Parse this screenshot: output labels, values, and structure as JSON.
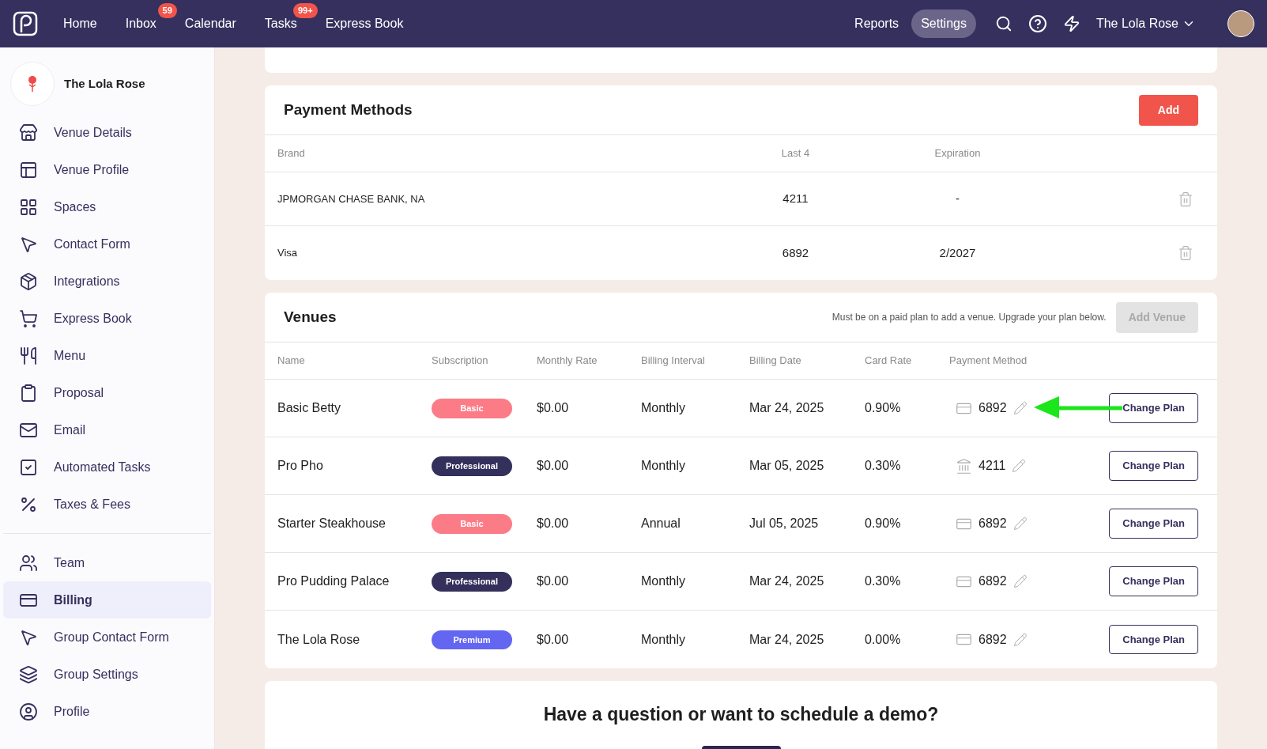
{
  "nav": {
    "items": [
      {
        "label": "Home"
      },
      {
        "label": "Inbox",
        "badge": "59"
      },
      {
        "label": "Calendar"
      },
      {
        "label": "Tasks",
        "badge": "99+"
      },
      {
        "label": "Express Book"
      }
    ],
    "right_tabs": [
      {
        "label": "Reports",
        "selected": false
      },
      {
        "label": "Settings",
        "selected": true
      }
    ],
    "account": "The Lola Rose"
  },
  "sidebar": {
    "venue_name": "The Lola Rose",
    "groups": [
      [
        {
          "label": "Venue Details",
          "selected": false
        },
        {
          "label": "Venue Profile",
          "selected": false
        },
        {
          "label": "Spaces",
          "selected": false
        },
        {
          "label": "Contact Form",
          "selected": false
        },
        {
          "label": "Integrations",
          "selected": false
        },
        {
          "label": "Express Book",
          "selected": false
        },
        {
          "label": "Menu",
          "selected": false
        },
        {
          "label": "Proposal",
          "selected": false
        },
        {
          "label": "Email",
          "selected": false
        },
        {
          "label": "Automated Tasks",
          "selected": false
        },
        {
          "label": "Taxes & Fees",
          "selected": false
        }
      ],
      [
        {
          "label": "Team",
          "selected": false
        },
        {
          "label": "Billing",
          "selected": true
        },
        {
          "label": "Group Contact Form",
          "selected": false
        },
        {
          "label": "Group Settings",
          "selected": false
        },
        {
          "label": "Profile",
          "selected": false
        }
      ]
    ]
  },
  "payment_methods": {
    "title": "Payment Methods",
    "add_button": "Add",
    "columns": [
      "Brand",
      "Last 4",
      "Expiration"
    ],
    "rows": [
      {
        "brand": "JPMORGAN CHASE BANK, NA",
        "last4": "4211",
        "expiration": "-"
      },
      {
        "brand": "Visa",
        "last4": "6892",
        "expiration": "2/2027"
      }
    ]
  },
  "venues": {
    "title": "Venues",
    "note": "Must be on a paid plan to add a venue. Upgrade your plan below.",
    "add_button": {
      "label": "Add Venue",
      "disabled": true
    },
    "columns": [
      "Name",
      "Subscription",
      "Monthly Rate",
      "Billing Interval",
      "Billing Date",
      "Card Rate",
      "Payment Method"
    ],
    "rows": [
      {
        "name": "Basic Betty",
        "plan": "Basic",
        "color": "#fb7c87",
        "rate": "$0.00",
        "interval": "Monthly",
        "date": "Mar 24, 2025",
        "card_rate": "0.90%",
        "kind": "card",
        "method": "6892",
        "action": "Change Plan"
      },
      {
        "name": "Pro Pho",
        "plan": "Professional",
        "color": "#33305c",
        "rate": "$0.00",
        "interval": "Monthly",
        "date": "Mar 05, 2025",
        "card_rate": "0.30%",
        "kind": "bank",
        "method": "4211",
        "action": "Change Plan"
      },
      {
        "name": "Starter Steakhouse",
        "plan": "Basic",
        "color": "#fb7c87",
        "rate": "$0.00",
        "interval": "Annual",
        "date": "Jul 05, 2025",
        "card_rate": "0.90%",
        "kind": "card",
        "method": "6892",
        "action": "Change Plan"
      },
      {
        "name": "Pro Pudding Palace",
        "plan": "Professional",
        "color": "#33305c",
        "rate": "$0.00",
        "interval": "Monthly",
        "date": "Mar 24, 2025",
        "card_rate": "0.30%",
        "kind": "card",
        "method": "6892",
        "action": "Change Plan"
      },
      {
        "name": "The Lola Rose",
        "plan": "Premium",
        "color": "#6366f1",
        "rate": "$0.00",
        "interval": "Monthly",
        "date": "Mar 24, 2025",
        "card_rate": "0.00%",
        "kind": "card",
        "method": "6892",
        "action": "Change Plan"
      }
    ]
  },
  "demo": {
    "title": "Have a question or want to schedule a demo?"
  }
}
